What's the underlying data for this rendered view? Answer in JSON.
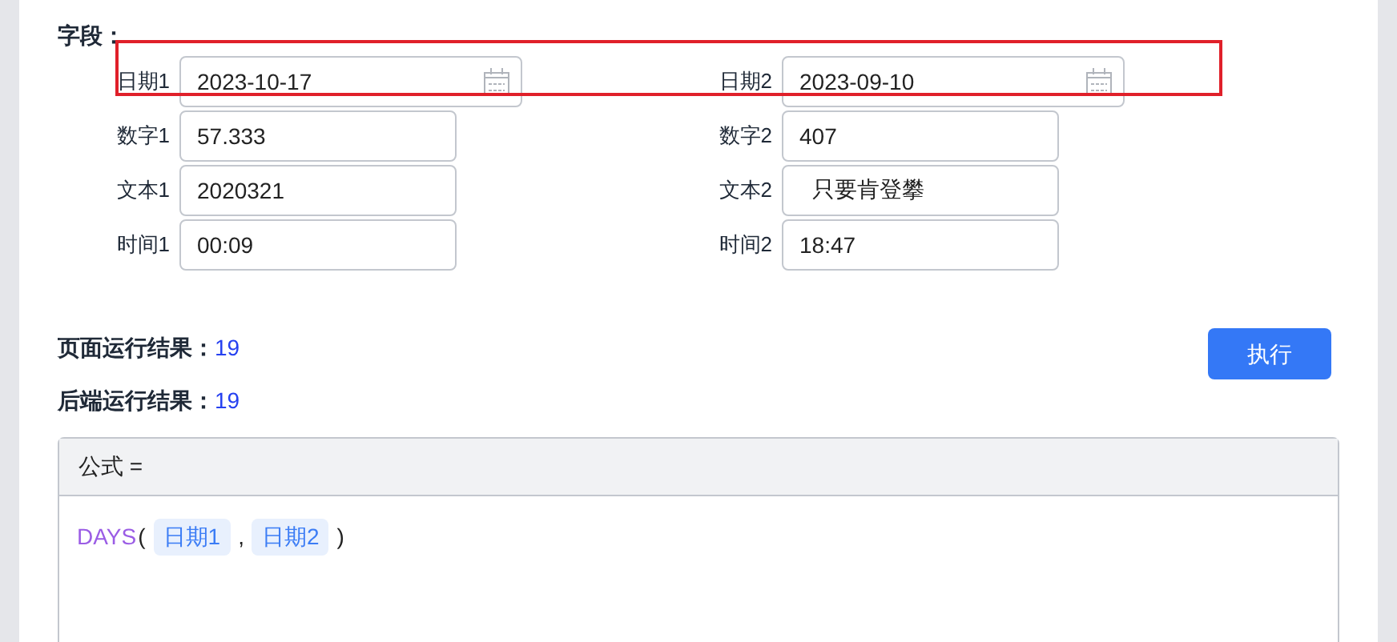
{
  "section_label": "字段：",
  "fields": [
    {
      "label": "日期1",
      "value": "2023-10-17",
      "kind": "date"
    },
    {
      "label": "日期2",
      "value": "2023-09-10",
      "kind": "date"
    },
    {
      "label": "数字1",
      "value": "57.333",
      "kind": "text"
    },
    {
      "label": "数字2",
      "value": "407",
      "kind": "text"
    },
    {
      "label": "文本1",
      "value": "2020321",
      "kind": "text"
    },
    {
      "label": "文本2",
      "value": "  只要肯登攀",
      "kind": "text"
    },
    {
      "label": "时间1",
      "value": "00:09",
      "kind": "text"
    },
    {
      "label": "时间2",
      "value": "18:47",
      "kind": "text"
    }
  ],
  "results": [
    {
      "label": "页面运行结果：",
      "value": "19"
    },
    {
      "label": "后端运行结果：",
      "value": "19"
    }
  ],
  "run_button": "执行",
  "formula": {
    "header": "公式 =",
    "tokens": [
      {
        "kind": "function",
        "text": "DAYS"
      },
      {
        "kind": "punct",
        "text": "("
      },
      {
        "kind": "field",
        "text": "日期1"
      },
      {
        "kind": "punct",
        "text": ","
      },
      {
        "kind": "field",
        "text": "日期2"
      },
      {
        "kind": "punct",
        "text": ")"
      }
    ]
  }
}
